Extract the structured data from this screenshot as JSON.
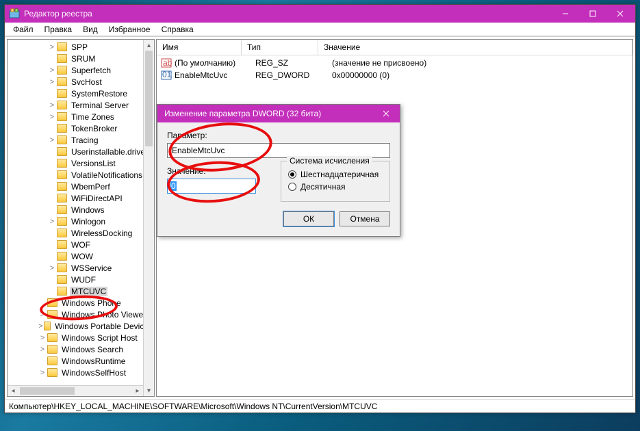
{
  "window": {
    "title": "Редактор реестра",
    "menu": [
      "Файл",
      "Правка",
      "Вид",
      "Избранное",
      "Справка"
    ]
  },
  "tree": {
    "items": [
      {
        "i": 4,
        "t": ">",
        "l": "SPP"
      },
      {
        "i": 4,
        "t": "",
        "l": "SRUM"
      },
      {
        "i": 4,
        "t": ">",
        "l": "Superfetch"
      },
      {
        "i": 4,
        "t": ">",
        "l": "SvcHost"
      },
      {
        "i": 4,
        "t": "",
        "l": "SystemRestore"
      },
      {
        "i": 4,
        "t": ">",
        "l": "Terminal Server"
      },
      {
        "i": 4,
        "t": ">",
        "l": "Time Zones"
      },
      {
        "i": 4,
        "t": "",
        "l": "TokenBroker"
      },
      {
        "i": 4,
        "t": ">",
        "l": "Tracing"
      },
      {
        "i": 4,
        "t": "",
        "l": "Userinstallable.drivers"
      },
      {
        "i": 4,
        "t": "",
        "l": "VersionsList"
      },
      {
        "i": 4,
        "t": "",
        "l": "VolatileNotifications"
      },
      {
        "i": 4,
        "t": "",
        "l": "WbemPerf"
      },
      {
        "i": 4,
        "t": "",
        "l": "WiFiDirectAPI"
      },
      {
        "i": 4,
        "t": "",
        "l": "Windows"
      },
      {
        "i": 4,
        "t": ">",
        "l": "Winlogon"
      },
      {
        "i": 4,
        "t": "",
        "l": "WirelessDocking"
      },
      {
        "i": 4,
        "t": "",
        "l": "WOF"
      },
      {
        "i": 4,
        "t": "",
        "l": "WOW"
      },
      {
        "i": 4,
        "t": ">",
        "l": "WSService"
      },
      {
        "i": 4,
        "t": "",
        "l": "WUDF"
      },
      {
        "i": 4,
        "t": "",
        "l": "MTCUVC",
        "sel": true
      },
      {
        "i": 3,
        "t": "",
        "l": "Windows Phone"
      },
      {
        "i": 3,
        "t": ">",
        "l": "Windows Photo Viewer"
      },
      {
        "i": 3,
        "t": ">",
        "l": "Windows Portable Devices"
      },
      {
        "i": 3,
        "t": ">",
        "l": "Windows Script Host"
      },
      {
        "i": 3,
        "t": ">",
        "l": "Windows Search"
      },
      {
        "i": 3,
        "t": "",
        "l": "WindowsRuntime"
      },
      {
        "i": 3,
        "t": ">",
        "l": "WindowsSelfHost"
      }
    ]
  },
  "list": {
    "headers": {
      "name": "Имя",
      "type": "Тип",
      "value": "Значение"
    },
    "rows": [
      {
        "icon": "sz",
        "name": "(По умолчанию)",
        "type": "REG_SZ",
        "value": "(значение не присвоено)"
      },
      {
        "icon": "dw",
        "name": "EnableMtcUvc",
        "type": "REG_DWORD",
        "value": "0x00000000 (0)"
      }
    ]
  },
  "status": "Компьютер\\HKEY_LOCAL_MACHINE\\SOFTWARE\\Microsoft\\Windows NT\\CurrentVersion\\MTCUVC",
  "dialog": {
    "title": "Изменение параметра DWORD (32 бита)",
    "param_label": "Параметр:",
    "param_value": "EnableMtcUvc",
    "value_label": "Значение:",
    "value_text": "0",
    "group_label": "Система исчисления",
    "radio_hex": "Шестнадцатеричная",
    "radio_dec": "Десятичная",
    "ok": "ОК",
    "cancel": "Отмена"
  }
}
